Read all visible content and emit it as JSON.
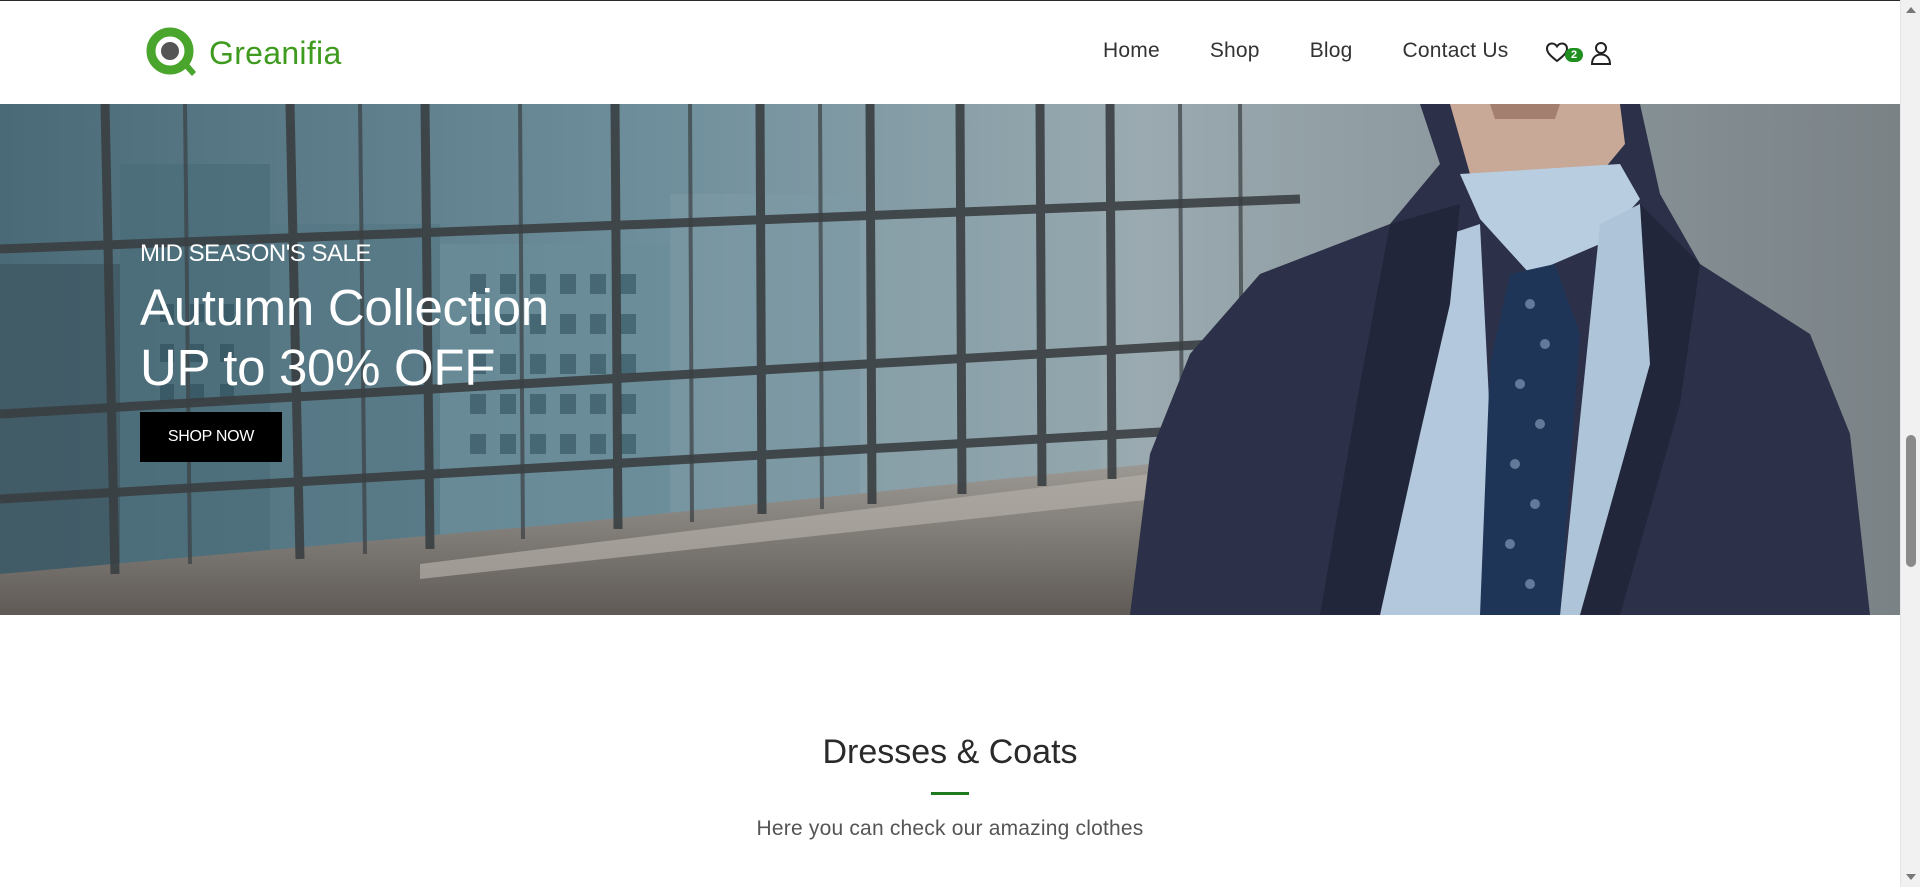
{
  "brand": {
    "name": "Greanifia",
    "color": "#3f9b1f"
  },
  "nav": {
    "items": [
      "Home",
      "Shop",
      "Blog",
      "Contact Us"
    ]
  },
  "header_icons": {
    "wishlist": "heart-icon",
    "wishlist_count": "2",
    "account": "user-icon"
  },
  "hero": {
    "subtitle": "MID SEASON'S SALE",
    "title_line1": "Autumn Collection",
    "title_line2": "UP to 30% OFF",
    "button": "SHOP NOW"
  },
  "section": {
    "title": "Dresses & Coats",
    "subtitle": "Here you can check our amazing clothes",
    "accent_color": "#1f7a1f"
  },
  "scrollbar": {
    "up": "scroll-up-arrow-icon",
    "down": "scroll-down-arrow-icon"
  }
}
